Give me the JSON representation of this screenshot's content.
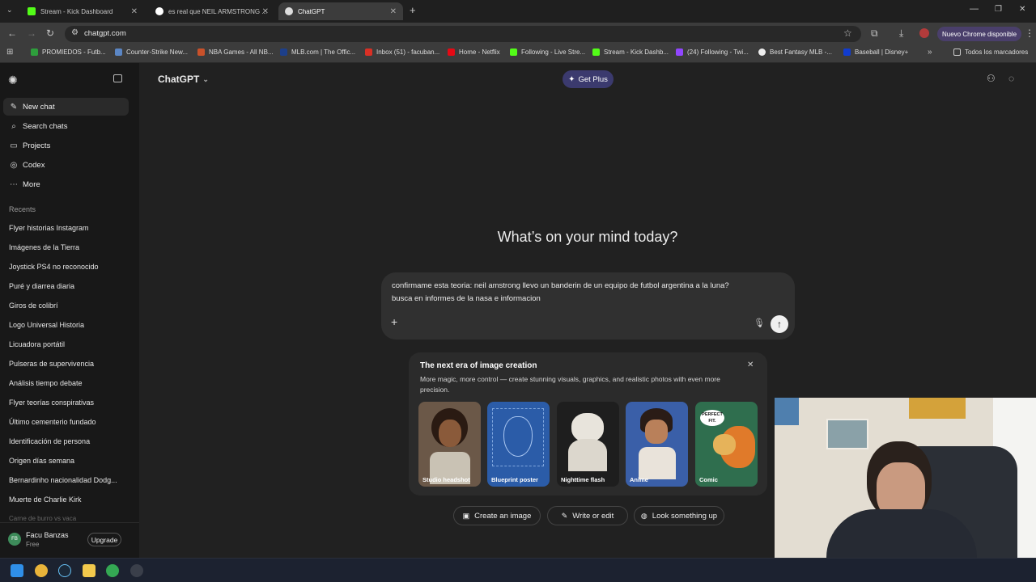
{
  "browser": {
    "tabs": [
      {
        "title": "Stream - Kick Dashboard"
      },
      {
        "title": "es real que NEIL ARMSTRONG ..."
      },
      {
        "title": "ChatGPT"
      }
    ],
    "url": "chatgpt.com",
    "update_button": "Nuevo Chrome disponible",
    "bookmarks": [
      "PROMIEDOS - Futb...",
      "Counter-Strike New...",
      "NBA Games - All NB...",
      "MLB.com | The Offic...",
      "Inbox (51) - facuban...",
      "Home - Netflix",
      "Following - Live Stre...",
      "Stream - Kick Dashb...",
      "(24) Following - Twi...",
      "Best Fantasy MLB -...",
      "Baseball | Disney+"
    ],
    "all_bookmarks": "Todos los marcadores"
  },
  "sidebar": {
    "nav": [
      {
        "label": "New chat",
        "icon": "edit-icon"
      },
      {
        "label": "Search chats",
        "icon": "search-icon"
      },
      {
        "label": "Projects",
        "icon": "folder-icon"
      },
      {
        "label": "Codex",
        "icon": "codex-icon"
      },
      {
        "label": "More",
        "icon": "more-icon"
      }
    ],
    "recents_label": "Recents",
    "recents": [
      "Flyer historias Instagram",
      "Imágenes de la Tierra",
      "Joystick PS4 no reconocido",
      "Puré y diarrea diaria",
      "Giros de colibrí",
      "Logo Universal Historia",
      "Licuadora portátil",
      "Pulseras de supervivencia",
      "Análisis tiempo debate",
      "Flyer teorías conspirativas",
      "Último cementerio fundado",
      "Identificación de persona",
      "Origen días semana",
      "Bernardinho nacionalidad Dodg...",
      "Muerte de Charlie Kirk",
      "Carne de burro vs vaca"
    ],
    "user": {
      "initials": "FB",
      "name": "Facu Banzas",
      "plan": "Free",
      "upgrade": "Upgrade"
    }
  },
  "header": {
    "title": "ChatGPT",
    "get_plus": "Get Plus"
  },
  "main": {
    "heading": "What’s on your mind today?",
    "composer_text_line1": "confirmame esta teoria: neil amstrong llevo un banderin de un equipo de futbol argentina a la luna?",
    "composer_text_line2": "busca en informes de la nasa e informacion"
  },
  "promo": {
    "title": "The next era of image creation",
    "desc": "More magic, more control — create stunning visuals, graphics, and realistic photos with even more precision.",
    "cards": [
      {
        "label": "Studio headshot",
        "color": "#6b5848"
      },
      {
        "label": "Blueprint poster",
        "color": "#2b5ca8"
      },
      {
        "label": "Nighttime flash",
        "color": "#1e1e1e"
      },
      {
        "label": "Anime",
        "color": "#3a5fa8"
      },
      {
        "label": "Comic",
        "color": "#2f6e4e"
      }
    ],
    "comic_bubble": "PERFECT FIT."
  },
  "actions": [
    {
      "label": "Create an image",
      "icon": "image-icon"
    },
    {
      "label": "Write or edit",
      "icon": "pencil-icon"
    },
    {
      "label": "Look something up",
      "icon": "globe-icon"
    }
  ],
  "colors": {
    "accent_plus": "#3b3a6e",
    "bg": "#212121",
    "sidebar": "#181818"
  }
}
